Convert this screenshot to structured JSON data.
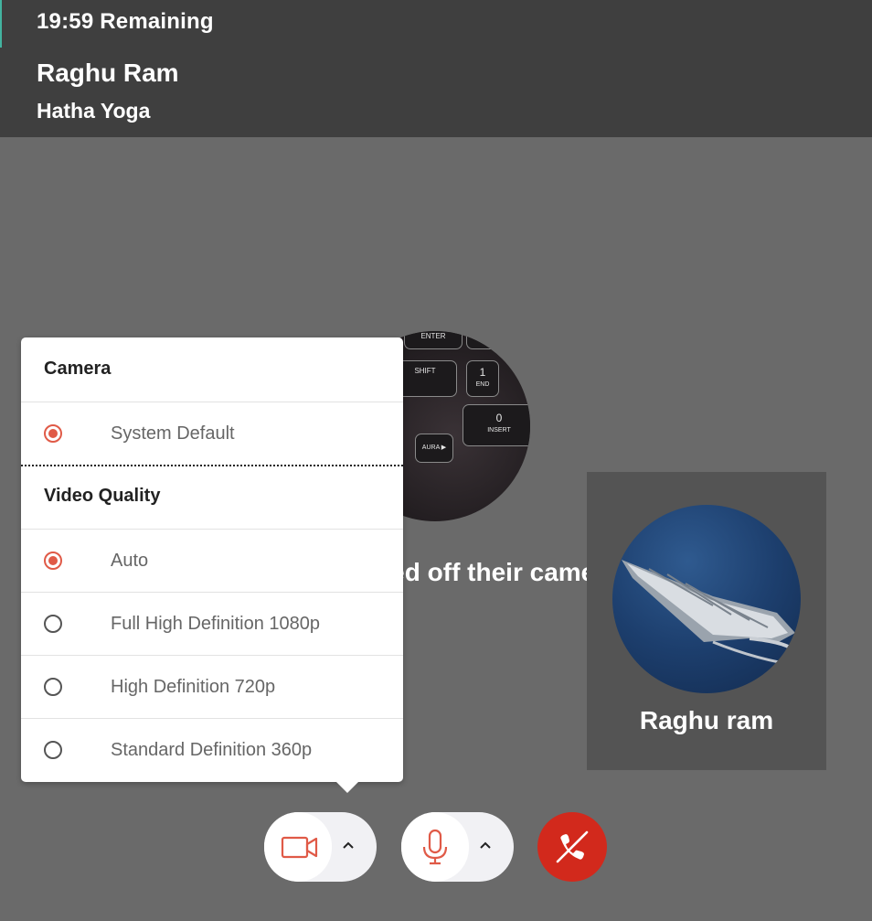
{
  "header": {
    "remaining": "19:59 Remaining",
    "host_name": "Raghu Ram",
    "session_name": "Hatha Yoga"
  },
  "main_video": {
    "status_text": "Raghu ram has switched off their camera",
    "keyboard_keys": [
      "ENTER",
      "SHIFT",
      "1",
      "END",
      "0",
      "INSERT",
      "AURA ▶"
    ]
  },
  "participant_tile": {
    "name": "Raghu ram"
  },
  "camera_menu": {
    "camera_heading": "Camera",
    "camera_options": [
      {
        "label": "System Default",
        "selected": true
      }
    ],
    "quality_heading": "Video Quality",
    "quality_options": [
      {
        "label": "Auto",
        "selected": true
      },
      {
        "label": "Full High Definition 1080p",
        "selected": false
      },
      {
        "label": "High Definition 720p",
        "selected": false
      },
      {
        "label": "Standard Definition 360p",
        "selected": false
      }
    ]
  },
  "controls": {
    "camera_icon": "video-camera-icon",
    "mic_icon": "microphone-icon",
    "end_icon": "hang-up-icon",
    "accent_color": "#e05a47",
    "end_color": "#d2291c"
  }
}
